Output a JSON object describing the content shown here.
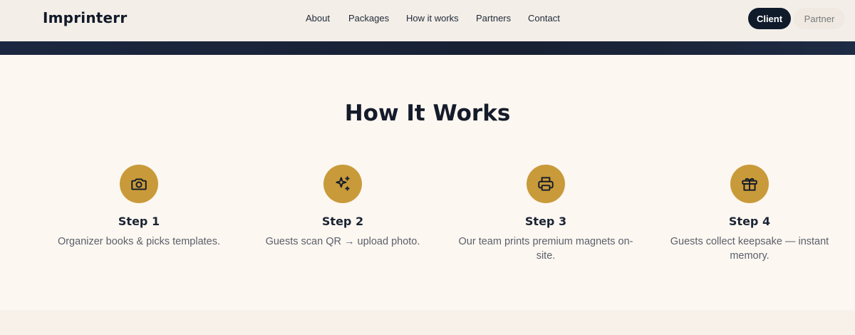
{
  "header": {
    "brand": "Imprinterr",
    "nav": [
      "About",
      "Packages",
      "How it works",
      "Partners",
      "Contact"
    ],
    "client_label": "Client",
    "partner_label": "Partner"
  },
  "how_it_works": {
    "title": "How It Works",
    "steps": [
      {
        "title": "Step 1",
        "text": "Organizer books & picks templates.",
        "icon": "camera-icon"
      },
      {
        "title": "Step 2",
        "text": "Guests scan QR → upload photo.",
        "icon": "sparkles-icon"
      },
      {
        "title": "Step 3",
        "text": "Our team prints premium magnets on-site.",
        "icon": "printer-icon"
      },
      {
        "title": "Step 4",
        "text": "Guests collect keepsake — instant memory.",
        "icon": "gift-icon"
      }
    ]
  },
  "colors": {
    "navy": "#0f1a2b",
    "gold": "#c99a3a",
    "cream": "#fdf7f1"
  }
}
